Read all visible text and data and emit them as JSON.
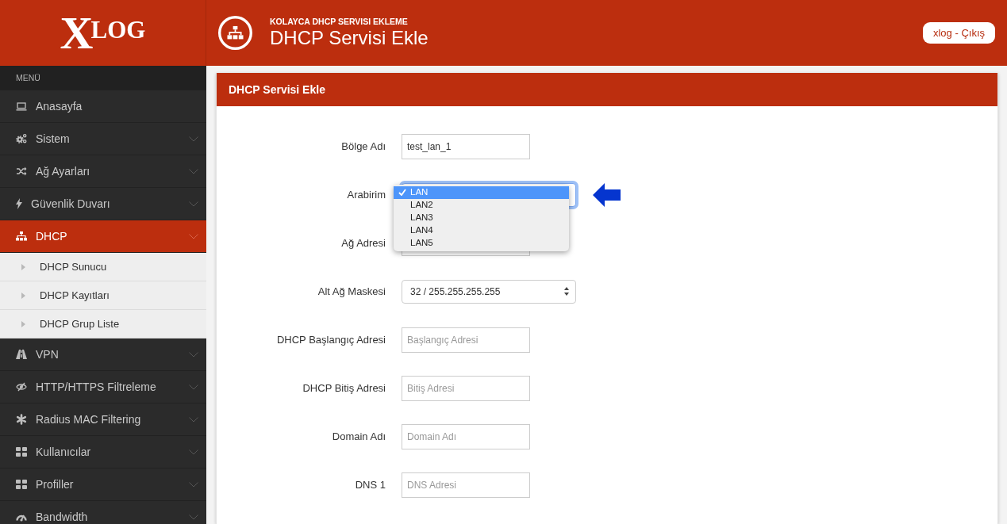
{
  "header": {
    "logo": "XLOG",
    "subtitle": "KOLAYCA DHCP SERVISI EKLEME",
    "title": "DHCP Servisi Ekle",
    "account_link": "xlog - Çıkış"
  },
  "sidebar": {
    "heading": "MENÜ",
    "items": [
      {
        "label": "Anasayfa",
        "selected": false,
        "expandable": false
      },
      {
        "label": "Sistem",
        "selected": false,
        "expandable": true,
        "expanded": false
      },
      {
        "label": "Ağ Ayarları",
        "selected": false,
        "expandable": true,
        "expanded": false
      },
      {
        "label": "Güvenlik Duvarı",
        "selected": false,
        "expandable": true,
        "expanded": false
      },
      {
        "label": "DHCP",
        "selected": true,
        "expandable": true,
        "expanded": true,
        "children": [
          {
            "label": "DHCP Sunucu",
            "selected": false
          },
          {
            "label": "DHCP Kayıtları",
            "selected": false
          },
          {
            "label": "DHCP Grup Liste",
            "selected": false
          }
        ]
      },
      {
        "label": "VPN",
        "selected": false,
        "expandable": true,
        "expanded": false
      },
      {
        "label": "HTTP/HTTPS Filtreleme",
        "selected": false,
        "expandable": true,
        "expanded": false
      },
      {
        "label": "Radius MAC Filtering",
        "selected": false,
        "expandable": true,
        "expanded": false
      },
      {
        "label": "Kullanıcılar",
        "selected": false,
        "expandable": true,
        "expanded": false
      },
      {
        "label": "Profiller",
        "selected": false,
        "expandable": true,
        "expanded": false
      },
      {
        "label": "Bandwidth",
        "selected": false,
        "expandable": true,
        "expanded": false
      }
    ]
  },
  "panel": {
    "title": "DHCP Servisi Ekle",
    "fields": [
      {
        "kind": "text",
        "label": "Bölge Adı",
        "value": "test_lan_1",
        "focused": false,
        "marked": false
      },
      {
        "kind": "select",
        "label": "Arabirim",
        "focused": true,
        "expanded": true,
        "marked": true,
        "options": [
          {
            "label": "LAN",
            "selected": true
          },
          {
            "label": "LAN2",
            "selected": false
          },
          {
            "label": "LAN3",
            "selected": false
          },
          {
            "label": "LAN4",
            "selected": false
          },
          {
            "label": "LAN5",
            "selected": false
          }
        ]
      },
      {
        "kind": "text",
        "label": "Ağ Adresi",
        "focused": false,
        "marked": false
      },
      {
        "kind": "select",
        "label": "Alt Ağ Maskesi",
        "value": "32 / 255.255.255.255",
        "focused": false,
        "marked": false
      },
      {
        "kind": "text",
        "label": "DHCP Başlangıç Adresi",
        "placeholder": "Başlangıç Adresi",
        "focused": false,
        "marked": false
      },
      {
        "kind": "text",
        "label": "DHCP Bitiş Adresi",
        "placeholder": "Bitiş Adresi",
        "focused": false,
        "marked": false
      },
      {
        "kind": "text",
        "label": "Domain Adı",
        "placeholder": "Domain Adı",
        "focused": false,
        "marked": false
      },
      {
        "kind": "text",
        "label": "DNS 1",
        "placeholder": "DNS Adresi",
        "focused": false,
        "marked": false
      }
    ]
  }
}
